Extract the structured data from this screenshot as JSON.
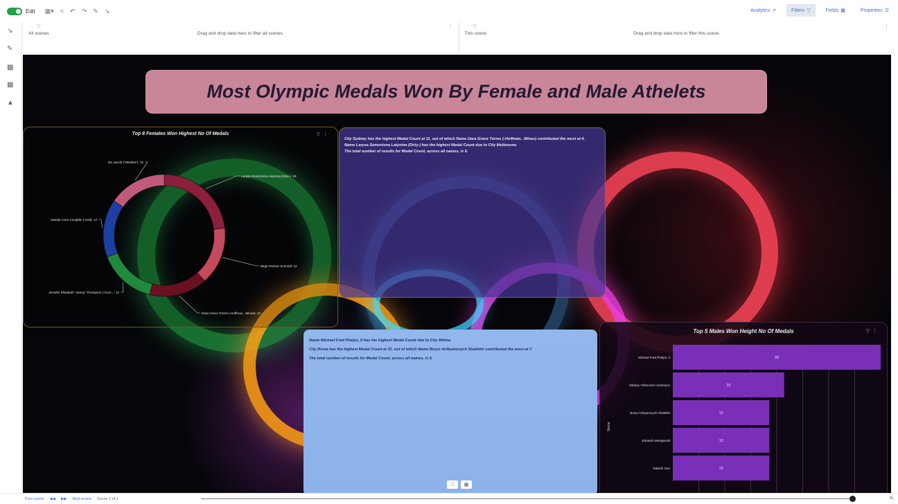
{
  "toolbar": {
    "edit_label": "Edit",
    "analytics_label": "Analytics",
    "filters_label": "Filters",
    "fields_label": "Fields",
    "properties_label": "Properties"
  },
  "filters": {
    "all_scenes_label": "All scenes",
    "all_scenes_hint": "Drag and drop data here to filter all scenes.",
    "this_scene_label": "This scene",
    "this_scene_hint": "Drag and drop data here to filter this scene."
  },
  "title": "Most Olympic Medals Won By Female and Male Athelets",
  "female_chart": {
    "title": "Top 8 Females Won Highest No Of Medals"
  },
  "text_top": {
    "line1": "City Sydney has the highest Medal Count at 11, out of which Name Dara Grace Torres (-Hoffman, -Minas) contributed the most at 4.",
    "line2": "Name Larysa Semenivna Latynina (Diriy-) has the highest Medal Count due to City Melbourne.",
    "line3": "The total number of results for Medal Count, across all names, is 6."
  },
  "text_bottom": {
    "line1": "Name Michael Fred Phelps, II has the highest Medal Count due to City Athina.",
    "line2": "City Roma has the highest Medal Count at 12, out of which Name Borys Anfiyanovych Shakhlin contributed the most at 7.",
    "line3": "The total number of results for Medal Count, across all names, is 6."
  },
  "male_chart": {
    "title": "Top 5 Males Won Height No Of  Medals"
  },
  "statusbar": {
    "prev_scene": "Prev scene",
    "next_scene": "Next scene",
    "scene_count": "Scene 1 of 1"
  },
  "chart_data": [
    {
      "type": "pie",
      "title": "Top 8 Females Won Highest No Of Medals",
      "donut": true,
      "categories": [
        "Larysa Semenivna Latynina (Diriy-)",
        "Birgit Fischer-Schmidt",
        "Dara Grace Torres (-Hoffman, -Minas)",
        "Jennifer Elisabeth \"Jenny\" Thompson (-Cum...",
        "Natalie Anne Coughlin (-Hall)",
        "Iris Jacobi (\"Wiebke\")"
      ],
      "values": [
        18,
        12,
        12,
        12,
        12,
        12
      ],
      "colors": [
        "#8c1f3b",
        "#c54a5c",
        "#6b1020",
        "#1f8a3c",
        "#1d3fa2",
        "#c05a7c"
      ]
    },
    {
      "type": "bar",
      "orientation": "horizontal",
      "title": "Top 5 Males Won Height No Of  Medals",
      "ylabel": "Name",
      "categories": [
        "Michael Fred Phelps, II",
        "Nikolay Yefimovich Andrianov",
        "Borys Anfiyanovych Shakhlin",
        "Edoardo Mangiarotti",
        "Takashi Ono"
      ],
      "values": [
        28,
        15,
        13,
        13,
        13
      ],
      "xlim": [
        0,
        28
      ],
      "color": "#7a2fb8"
    }
  ]
}
